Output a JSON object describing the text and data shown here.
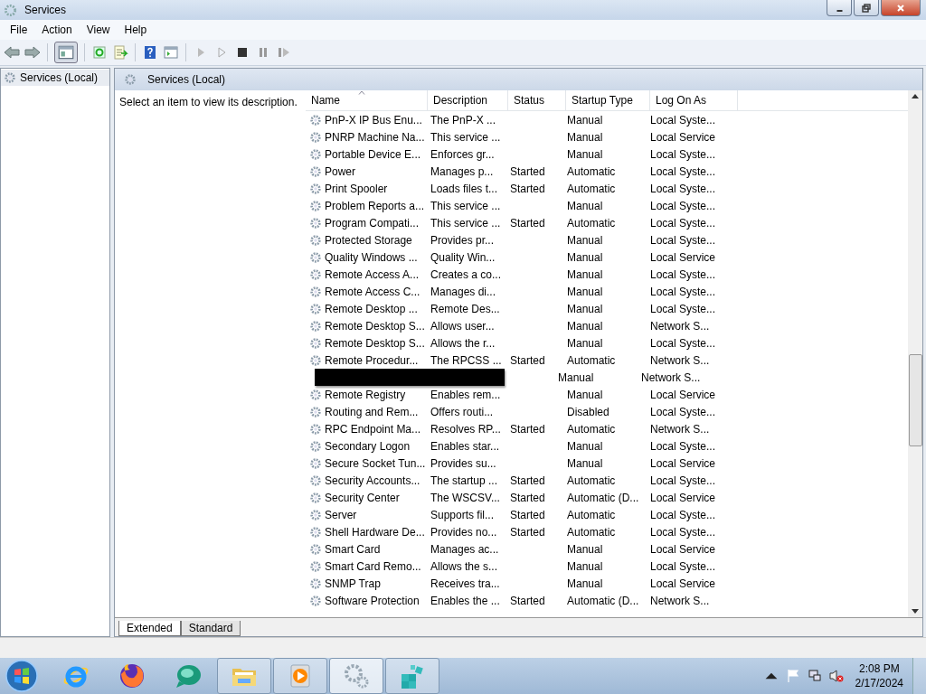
{
  "window": {
    "title": "Services"
  },
  "menu": [
    "File",
    "Action",
    "View",
    "Help"
  ],
  "tree": {
    "items": [
      {
        "label": "Services (Local)",
        "selected": true
      }
    ]
  },
  "panel": {
    "title": "Services (Local)",
    "description": "Select an item to view its description."
  },
  "table": {
    "columns": [
      {
        "label": "Name",
        "sorted": true
      },
      {
        "label": "Description",
        "sorted": false
      },
      {
        "label": "Status",
        "sorted": false
      },
      {
        "label": "Startup Type",
        "sorted": false
      },
      {
        "label": "Log On As",
        "sorted": false
      }
    ],
    "rows": [
      {
        "kind": "service",
        "name": "PnP-X IP Bus Enu...",
        "description": "The PnP-X ...",
        "startup": "Manual",
        "logon": "Local Syste..."
      },
      {
        "kind": "service",
        "name": "PNRP Machine Na...",
        "description": "This service ...",
        "startup": "Manual",
        "logon": "Local Service"
      },
      {
        "kind": "service",
        "name": "Portable Device E...",
        "description": "Enforces gr...",
        "startup": "Manual",
        "logon": "Local Syste..."
      },
      {
        "kind": "service",
        "name": "Power",
        "description": "Manages p...",
        "status": "Started",
        "startup": "Automatic",
        "logon": "Local Syste..."
      },
      {
        "kind": "service",
        "name": "Print Spooler",
        "description": "Loads files t...",
        "status": "Started",
        "startup": "Automatic",
        "logon": "Local Syste..."
      },
      {
        "kind": "service",
        "name": "Problem Reports a...",
        "description": "This service ...",
        "startup": "Manual",
        "logon": "Local Syste..."
      },
      {
        "kind": "service",
        "name": "Program Compati...",
        "description": "This service ...",
        "status": "Started",
        "startup": "Automatic",
        "logon": "Local Syste..."
      },
      {
        "kind": "service",
        "name": "Protected Storage",
        "description": "Provides pr...",
        "startup": "Manual",
        "logon": "Local Syste..."
      },
      {
        "kind": "service",
        "name": "Quality Windows ...",
        "description": "Quality Win...",
        "startup": "Manual",
        "logon": "Local Service"
      },
      {
        "kind": "service",
        "name": "Remote Access A...",
        "description": "Creates a co...",
        "startup": "Manual",
        "logon": "Local Syste..."
      },
      {
        "kind": "service",
        "name": "Remote Access C...",
        "description": "Manages di...",
        "startup": "Manual",
        "logon": "Local Syste..."
      },
      {
        "kind": "service",
        "name": "Remote Desktop ...",
        "description": "Remote Des...",
        "startup": "Manual",
        "logon": "Local Syste..."
      },
      {
        "kind": "service",
        "name": "Remote Desktop S...",
        "description": "Allows user...",
        "startup": "Manual",
        "logon": "Network S..."
      },
      {
        "kind": "service",
        "name": "Remote Desktop S...",
        "description": "Allows the r...",
        "startup": "Manual",
        "logon": "Local Syste..."
      },
      {
        "kind": "service",
        "name": "Remote Procedur...",
        "description": "The RPCSS ...",
        "status": "Started",
        "startup": "Automatic",
        "logon": "Network S..."
      },
      {
        "kind": "redacted",
        "startup": "Manual",
        "logon": "Network S..."
      },
      {
        "kind": "service",
        "name": "Remote Registry",
        "description": "Enables rem...",
        "startup": "Manual",
        "logon": "Local Service"
      },
      {
        "kind": "service",
        "name": "Routing and Rem...",
        "description": "Offers routi...",
        "startup": "Disabled",
        "logon": "Local Syste..."
      },
      {
        "kind": "service",
        "name": "RPC Endpoint Ma...",
        "description": "Resolves RP...",
        "status": "Started",
        "startup": "Automatic",
        "logon": "Network S..."
      },
      {
        "kind": "service",
        "name": "Secondary Logon",
        "description": "Enables star...",
        "startup": "Manual",
        "logon": "Local Syste..."
      },
      {
        "kind": "service",
        "name": "Secure Socket Tun...",
        "description": "Provides su...",
        "startup": "Manual",
        "logon": "Local Service"
      },
      {
        "kind": "service",
        "name": "Security Accounts...",
        "description": "The startup ...",
        "status": "Started",
        "startup": "Automatic",
        "logon": "Local Syste..."
      },
      {
        "kind": "service",
        "name": "Security Center",
        "description": "The WSCSV...",
        "status": "Started",
        "startup": "Automatic (D...",
        "logon": "Local Service"
      },
      {
        "kind": "service",
        "name": "Server",
        "description": "Supports fil...",
        "status": "Started",
        "startup": "Automatic",
        "logon": "Local Syste..."
      },
      {
        "kind": "service",
        "name": "Shell Hardware De...",
        "description": "Provides no...",
        "status": "Started",
        "startup": "Automatic",
        "logon": "Local Syste..."
      },
      {
        "kind": "service",
        "name": "Smart Card",
        "description": "Manages ac...",
        "startup": "Manual",
        "logon": "Local Service"
      },
      {
        "kind": "service",
        "name": "Smart Card Remo...",
        "description": "Allows the s...",
        "startup": "Manual",
        "logon": "Local Syste..."
      },
      {
        "kind": "service",
        "name": "SNMP Trap",
        "description": "Receives tra...",
        "startup": "Manual",
        "logon": "Local Service"
      },
      {
        "kind": "service",
        "name": "Software Protection",
        "description": "Enables the ...",
        "status": "Started",
        "startup": "Automatic (D...",
        "logon": "Network S..."
      }
    ]
  },
  "tabs": [
    {
      "label": "Extended",
      "selected": true
    },
    {
      "label": "Standard",
      "selected": false
    }
  ],
  "taskbar": {
    "apps": [
      {
        "kind": "ie",
        "open": false,
        "active": false
      },
      {
        "kind": "firefox",
        "open": false,
        "active": false
      },
      {
        "kind": "bubble",
        "open": false,
        "active": false
      },
      {
        "kind": "folder",
        "open": true,
        "active": false
      },
      {
        "kind": "media",
        "open": true,
        "active": false
      },
      {
        "kind": "gears",
        "open": true,
        "active": true
      },
      {
        "kind": "cubes",
        "open": true,
        "active": false
      }
    ],
    "time": "2:08 PM",
    "date": "2/17/2024"
  }
}
